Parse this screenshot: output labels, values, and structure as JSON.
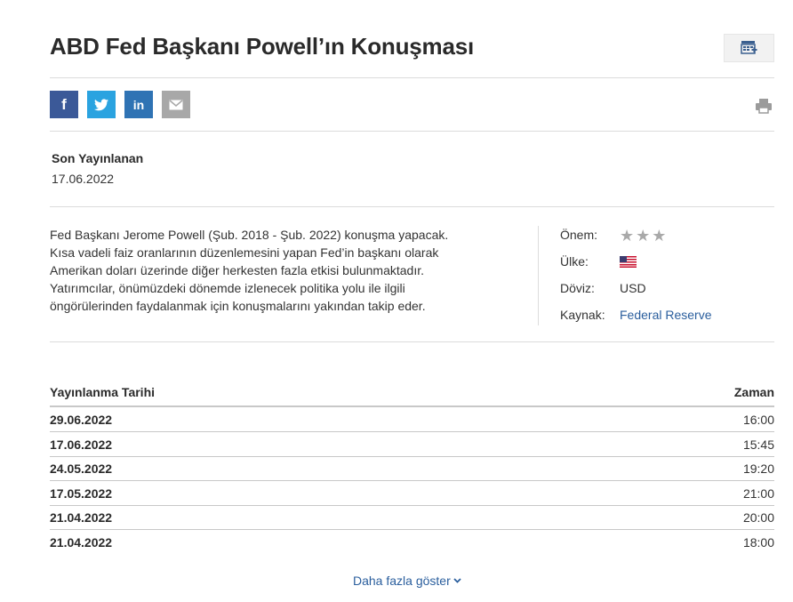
{
  "header": {
    "title": "ABD Fed Başkanı Powell’ın Konuşması"
  },
  "share": {
    "facebook_icon": "f",
    "linkedin_icon": "in"
  },
  "latest": {
    "label": "Son Yayınlanan",
    "date": "17.06.2022"
  },
  "description": [
    "Fed Başkanı Jerome Powell (Şub. 2018 - Şub. 2022) konuşma yapacak.",
    "Kısa vadeli faiz oranlarının düzenlemesini yapan Fed’in başkanı olarak",
    "Amerikan doları üzerinde diğer herkesten fazla etkisi bulunmaktadır.",
    "Yatırımcılar, önümüzdeki dönemde izlenecek politika yolu ile ilgili",
    "öngörülerinden faydalanmak için konuşmalarını yakından takip eder."
  ],
  "details": {
    "importance_label": "Önem:",
    "importance_stars": 0,
    "country_label": "Ülke:",
    "country_flag": "us-flag",
    "currency_label": "Döviz:",
    "currency_value": "USD",
    "source_label": "Kaynak:",
    "source_value": "Federal Reserve"
  },
  "table": {
    "col_date": "Yayınlanma Tarihi",
    "col_time": "Zaman",
    "rows": [
      {
        "date": "29.06.2022",
        "time": "16:00"
      },
      {
        "date": "17.06.2022",
        "time": "15:45"
      },
      {
        "date": "24.05.2022",
        "time": "19:20"
      },
      {
        "date": "17.05.2022",
        "time": "21:00"
      },
      {
        "date": "21.04.2022",
        "time": "20:00"
      },
      {
        "date": "21.04.2022",
        "time": "18:00"
      }
    ]
  },
  "more": {
    "label": "Daha fazla göster"
  },
  "colors": {
    "link": "#2a5e9d",
    "facebook": "#3b5998",
    "twitter": "#2aa3e0",
    "linkedin": "#2f73b4",
    "email": "#a8a8a8"
  }
}
